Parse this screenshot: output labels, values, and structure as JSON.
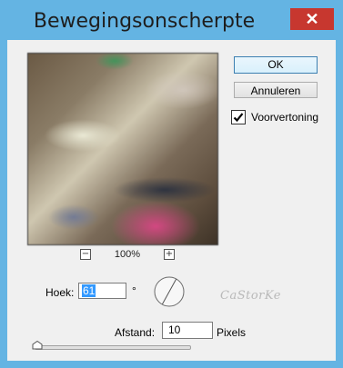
{
  "window": {
    "title": "Bewegingsonscherpte",
    "close_symbol": "✕"
  },
  "preview": {
    "zoom_level": "100%",
    "zoom_out_symbol": "−",
    "zoom_in_symbol": "+"
  },
  "buttons": {
    "ok_label": "OK",
    "cancel_label": "Annuleren"
  },
  "preview_toggle": {
    "label": "Voorvertoning",
    "checked": true
  },
  "angle": {
    "label": "Hoek:",
    "value": "61",
    "unit": "°"
  },
  "distance": {
    "label": "Afstand:",
    "value": "10",
    "unit": "Pixels",
    "slider_fraction": 0.0
  },
  "watermark": {
    "text": "CaStorKe"
  },
  "colors": {
    "title_bar": "#64b4e3",
    "close_button": "#c7372f",
    "selection": "#3399ff",
    "default_button_border": "#3c7fb1"
  },
  "icons": {
    "close": "close-icon",
    "zoom_out": "zoom-out-icon",
    "zoom_in": "zoom-in-icon",
    "checkmark": "checkmark-icon",
    "angle_dial": "angle-dial-icon",
    "slider_thumb": "slider-thumb-icon"
  }
}
